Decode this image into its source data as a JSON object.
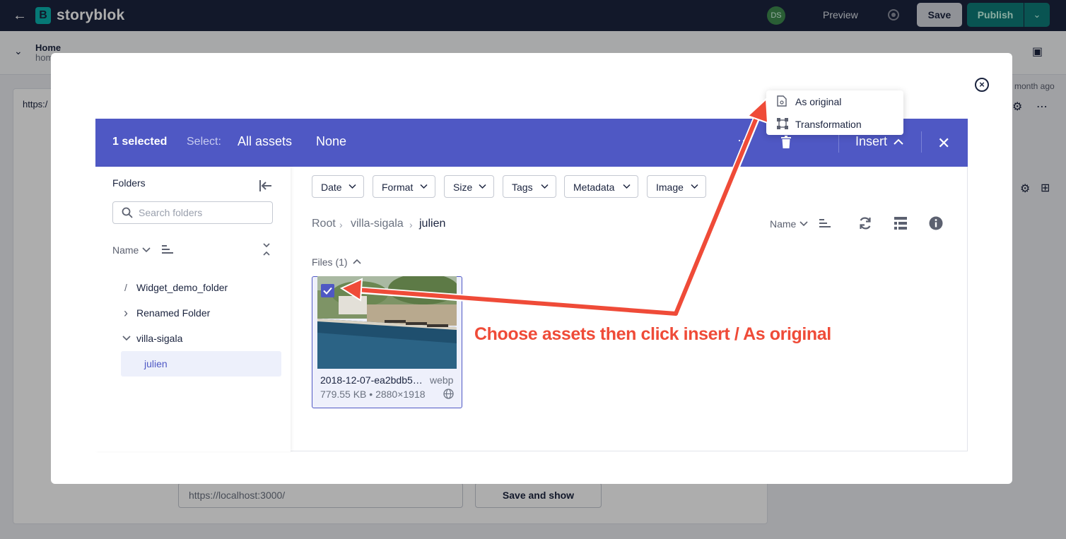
{
  "topbar": {
    "logo_text": "storyblok",
    "logo_letter": "B",
    "avatar_initials": "DS",
    "preview_label": "Preview",
    "save_label": "Save",
    "publish_label": "Publish"
  },
  "background": {
    "story_title": "Home",
    "story_slug": "hom",
    "url_prefix": "https:/",
    "updated_ago": "month ago",
    "preview_url": "https://localhost:3000/",
    "save_show_label": "Save and show"
  },
  "picker": {
    "selected_count": "1 selected",
    "select_label": "Select:",
    "select_all": "All assets",
    "select_none": "None",
    "more_dots": "··",
    "insert_label": "Insert",
    "insert_menu": [
      "As original",
      "Transformation"
    ],
    "folders_title": "Folders",
    "search_placeholder": "Search folders",
    "sort_label": "Name",
    "folders": [
      {
        "name": "Widget_demo_folder",
        "glyph": "/"
      },
      {
        "name": "Renamed Folder",
        "glyph": "›"
      },
      {
        "name": "villa-sigala",
        "glyph": "⌄"
      },
      {
        "name": "julien",
        "glyph": ""
      }
    ],
    "filters": [
      "Date",
      "Format",
      "Size",
      "Tags",
      "Metadata",
      "Image"
    ],
    "breadcrumb": [
      "Root",
      "villa-sigala",
      "julien"
    ],
    "list_sort_label": "Name",
    "files_label": "Files (1)",
    "asset": {
      "name": "2018-12-07-ea2bdb5e...",
      "format": "webp",
      "meta": "779.55 KB • 2880×1918",
      "checked": true
    }
  },
  "annotation_text": "Choose assets then click insert / As original",
  "colors": {
    "header": "#4f58c4",
    "topbar": "#1b243f",
    "publish": "#0e7d7a",
    "annotation": "#ef4b38"
  }
}
